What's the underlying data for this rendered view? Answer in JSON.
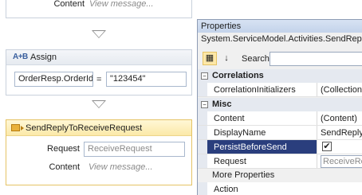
{
  "designer": {
    "top_activity": {
      "content_label": "Content",
      "content_hint": "View message..."
    },
    "assign": {
      "icon_text": "A+B",
      "title": "Assign",
      "to_value": "OrderResp.OrderId",
      "operator": "=",
      "value_value": "\"123454\""
    },
    "send_reply": {
      "title": "SendReplyToReceiveRequest",
      "request_label": "Request",
      "request_value": "ReceiveRequest",
      "content_label": "Content",
      "content_hint": "View message..."
    }
  },
  "properties": {
    "title": "Properties",
    "type_name": "System.ServiceModel.Activities.SendReply",
    "search_label": "Search:",
    "categories": [
      {
        "name": "Correlations",
        "rows": [
          {
            "name": "CorrelationInitializers",
            "value": "(Collection)"
          }
        ]
      },
      {
        "name": "Misc",
        "rows": [
          {
            "name": "Content",
            "value": "(Content)"
          },
          {
            "name": "DisplayName",
            "value": "SendReply"
          },
          {
            "name": "PersistBeforeSend",
            "value": "✔"
          },
          {
            "name": "Request",
            "value": "ReceiveRe"
          }
        ]
      }
    ],
    "more_properties_label": "More Properties",
    "partial_row_label": "Action"
  }
}
